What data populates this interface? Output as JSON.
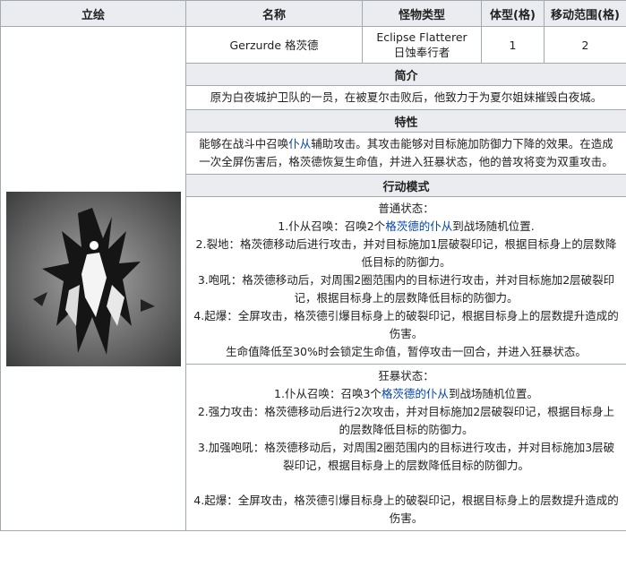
{
  "headers": {
    "image": "立绘",
    "name": "名称",
    "type": "怪物类型",
    "size": "体型(格)",
    "move": "移动范围(格)"
  },
  "info": {
    "name": "Gerzurde 格茨德",
    "type_en": "Eclipse Flatterer",
    "type_cn": "日蚀奉行者",
    "size": "1",
    "move": "2"
  },
  "intro": {
    "title": "简介",
    "text": "原为白夜城护卫队的一员，在被夏尔击败后，他致力于为夏尔姐妹摧毁白夜城。"
  },
  "trait": {
    "title": "特性",
    "pre": "能够在战斗中召唤",
    "link": "仆从",
    "post": "辅助攻击。其攻击能够对目标施加防御力下降的效果。在造成一次全屏伤害后，格茨德恢复生命值，并进入狂暴状态，他的普攻将变为双重攻击。"
  },
  "behavior": {
    "title": "行动模式",
    "normal": {
      "heading": "普通状态：",
      "l1_pre": "1.仆从召唤：召唤2个",
      "l1_link": "格茨德的仆从",
      "l1_post": "到战场随机位置.",
      "l2": "2.裂地：格茨德移动后进行攻击，并对目标施加1层破裂印记，根据目标身上的层数降低目标的防御力。",
      "l3": "3.咆吼：格茨德移动后，对周围2圈范围内的目标进行攻击，并对目标施加2层破裂印记，根据目标身上的层数降低目标的防御力。",
      "l4": "4.起爆：全屏攻击，格茨德引爆目标身上的破裂印记，根据目标身上的层数提升造成的伤害。",
      "l5": "生命值降低至30%时会锁定生命值，暂停攻击一回合，并进入狂暴状态。"
    },
    "rage": {
      "heading": "狂暴状态：",
      "l1_pre": "1.仆从召唤：召唤3个",
      "l1_link": "格茨德的仆从",
      "l1_post": "到战场随机位置。",
      "l2": "2.强力攻击：格茨德移动后进行2次攻击，并对目标施加2层破裂印记，根据目标身上的层数降低目标的防御力。",
      "l3": "3.加强咆吼：格茨德移动后，对周围2圈范围内的目标进行攻击，并对目标施加3层破裂印记，根据目标身上的层数降低目标的防御力。",
      "l4": "4.起爆：全屏攻击，格茨德引爆目标身上的破裂印记，根据目标身上的层数提升造成的伤害。"
    }
  },
  "colors": {
    "header_bg": "#eaecf0",
    "border": "#a2a9b1",
    "link": "#0645ad"
  }
}
